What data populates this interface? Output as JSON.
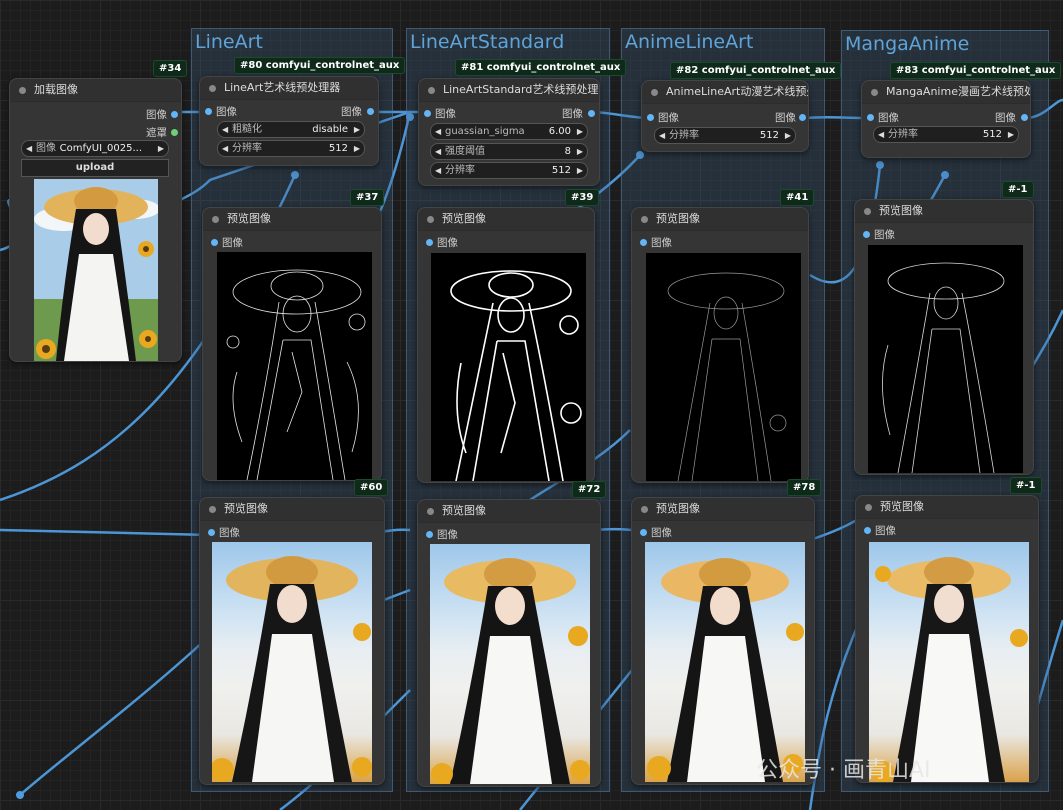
{
  "groups": {
    "g1": "LineArt",
    "g2": "LineArtStandard",
    "g3": "AnimeLineArt",
    "g4": "MangaAnime"
  },
  "load_node": {
    "badge": "#34",
    "title": "加载图像",
    "out_image": "图像",
    "out_mask": "遮罩",
    "image_label": "图像",
    "image_value": "ComfyUI_0025...",
    "upload_label": "upload"
  },
  "lineart_node": {
    "badge": "#80 comfyui_controlnet_aux",
    "title": "LineArt艺术线预处理器",
    "in_image": "图像",
    "out_image": "图像",
    "w1_label": "粗糙化",
    "w1_value": "disable",
    "w2_label": "分辨率",
    "w2_value": "512"
  },
  "standard_node": {
    "badge": "#81 comfyui_controlnet_aux",
    "title": "LineArtStandard艺术线预处理器",
    "in_image": "图像",
    "out_image": "图像",
    "w1_label": "guassian_sigma",
    "w1_value": "6.00",
    "w2_label": "强度阈值",
    "w2_value": "8",
    "w3_label": "分辨率",
    "w3_value": "512"
  },
  "anime_node": {
    "badge": "#82 comfyui_controlnet_aux",
    "title": "AnimeLineArt动漫艺术线预处理器",
    "in_image": "图像",
    "out_image": "图像",
    "w1_label": "分辨率",
    "w1_value": "512"
  },
  "manga_node": {
    "badge": "#83 comfyui_controlnet_aux",
    "title": "MangaAnime漫画艺术线预处理器",
    "in_image": "图像",
    "out_image": "图像",
    "w1_label": "分辨率",
    "w1_value": "512"
  },
  "preview_nodes": [
    {
      "badge": "#37",
      "title": "预览图像",
      "in_image": "图像"
    },
    {
      "badge": "#39",
      "title": "预览图像",
      "in_image": "图像"
    },
    {
      "badge": "#41",
      "title": "预览图像",
      "in_image": "图像"
    },
    {
      "badge": "#-1",
      "title": "预览图像",
      "in_image": "图像"
    },
    {
      "badge": "#60",
      "title": "预览图像",
      "in_image": "图像"
    },
    {
      "badge": "#72",
      "title": "预览图像",
      "in_image": "图像"
    },
    {
      "badge": "#78",
      "title": "预览图像",
      "in_image": "图像"
    },
    {
      "badge": "#-1",
      "title": "预览图像",
      "in_image": "图像"
    }
  ],
  "watermark": "公众号 · 画青山AI",
  "colors": {
    "wire": "#4f9de0",
    "group_title": "#5fa4d8",
    "node_bg": "#353535",
    "badge_bg": "#0f2a1a"
  }
}
